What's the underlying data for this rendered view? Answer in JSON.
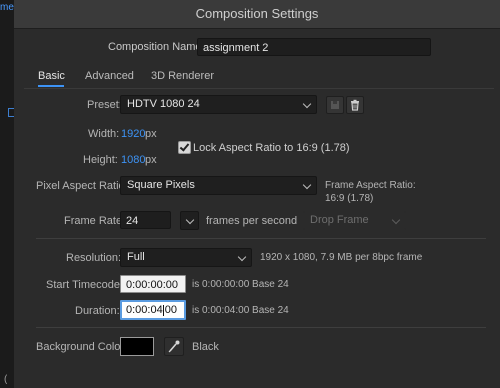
{
  "background": {
    "fragment_top": "mene",
    "fragment_bottom": "("
  },
  "dialog": {
    "title": "Composition Settings"
  },
  "composition_name": {
    "label": "Composition Name:",
    "value": "assignment 2"
  },
  "tabs": [
    {
      "label": "Basic",
      "active": true
    },
    {
      "label": "Advanced",
      "active": false
    },
    {
      "label": "3D Renderer",
      "active": false
    }
  ],
  "preset": {
    "label": "Preset:",
    "value": "HDTV 1080 24"
  },
  "width": {
    "label": "Width:",
    "value": "1920",
    "unit": "px"
  },
  "height": {
    "label": "Height:",
    "value": "1080",
    "unit": "px"
  },
  "lock_aspect": {
    "label": "Lock Aspect Ratio to 16:9 (1.78)",
    "checked": true
  },
  "pixel_aspect": {
    "label": "Pixel Aspect Ratio:",
    "value": "Square Pixels"
  },
  "frame_aspect": {
    "label": "Frame Aspect Ratio:",
    "value": "16:9 (1.78)"
  },
  "frame_rate": {
    "label": "Frame Rate:",
    "value": "24",
    "unit": "frames per second",
    "drop_frame": "Drop Frame"
  },
  "resolution": {
    "label": "Resolution:",
    "value": "Full",
    "info": "1920 x 1080, 7.9 MB per 8bpc frame"
  },
  "start_timecode": {
    "label": "Start Timecode:",
    "value": "0:00:00:00",
    "info": "is 0:00:00:00  Base 24"
  },
  "duration": {
    "label": "Duration:",
    "value_before_caret": "0:00:04",
    "value_after_caret": "00",
    "info": "is 0:00:04:00  Base 24"
  },
  "background_color": {
    "label": "Background Color:",
    "color": "#000000",
    "name": "Black"
  },
  "colors": {
    "accent": "#3d93f5",
    "dialog_bg": "#2b2b2b",
    "titlebar_bg": "#3a3a3a"
  }
}
